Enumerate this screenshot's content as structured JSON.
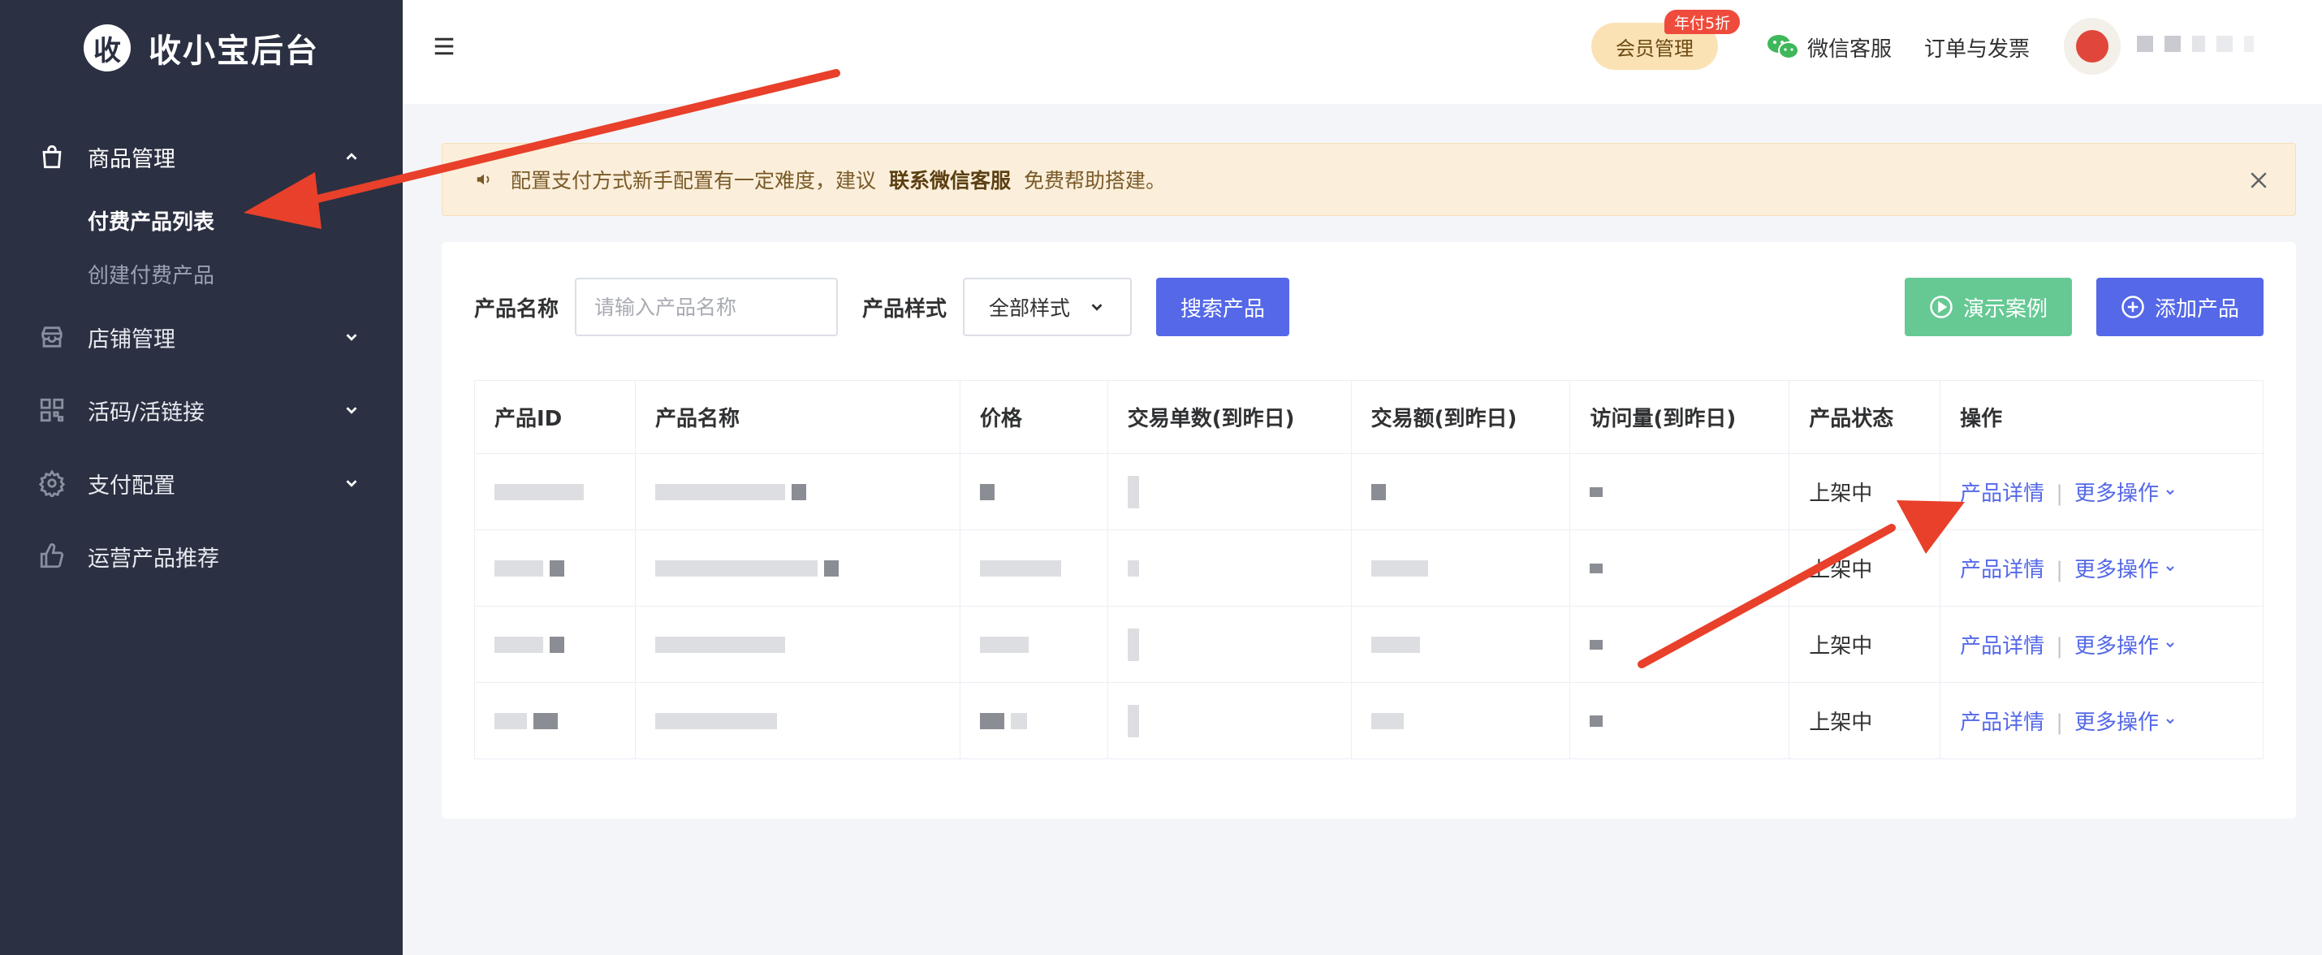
{
  "brand": {
    "logo_char": "收",
    "title": "收小宝后台"
  },
  "sidebar": {
    "groups": [
      {
        "label": "商品管理",
        "icon": "bag-icon",
        "expanded": true
      },
      {
        "label": "店铺管理",
        "icon": "store-icon",
        "expanded": false
      },
      {
        "label": "活码/活链接",
        "icon": "qrcode-icon",
        "expanded": false
      },
      {
        "label": "支付配置",
        "icon": "gear-icon",
        "expanded": false
      },
      {
        "label": "运营产品推荐",
        "icon": "thumb-up-icon"
      }
    ],
    "sub_items": [
      {
        "label": "付费产品列表",
        "active": true
      },
      {
        "label": "创建付费产品",
        "active": false
      }
    ]
  },
  "header": {
    "vip_label": "会员管理",
    "vip_badge": "年付5折",
    "wechat_label": "微信客服",
    "orders_label": "订单与发票"
  },
  "notice": {
    "text_before": "配置支付方式新手配置有一定难度，建议",
    "highlight": "联系微信客服",
    "text_after": "免费帮助搭建。"
  },
  "filters": {
    "name_label": "产品名称",
    "name_placeholder": "请输入产品名称",
    "style_label": "产品样式",
    "style_value": "全部样式",
    "search_button": "搜索产品",
    "demo_button": "演示案例",
    "add_button": "添加产品"
  },
  "table": {
    "headers": [
      "产品ID",
      "产品名称",
      "价格",
      "交易单数(到昨日)",
      "交易额(到昨日)",
      "访问量(到昨日)",
      "产品状态",
      "操作"
    ],
    "rows": [
      {
        "status": "上架中",
        "detail": "产品详情",
        "more": "更多操作"
      },
      {
        "status": "上架中",
        "detail": "产品详情",
        "more": "更多操作"
      },
      {
        "status": "上架中",
        "detail": "产品详情",
        "more": "更多操作"
      },
      {
        "status": "上架中",
        "detail": "产品详情",
        "more": "更多操作"
      }
    ]
  },
  "colors": {
    "sidebar_bg": "#2b3042",
    "primary": "#5468e8",
    "success": "#4fbf7b",
    "demo_button": "#66c994",
    "annotation_arrow": "#e8402a"
  }
}
